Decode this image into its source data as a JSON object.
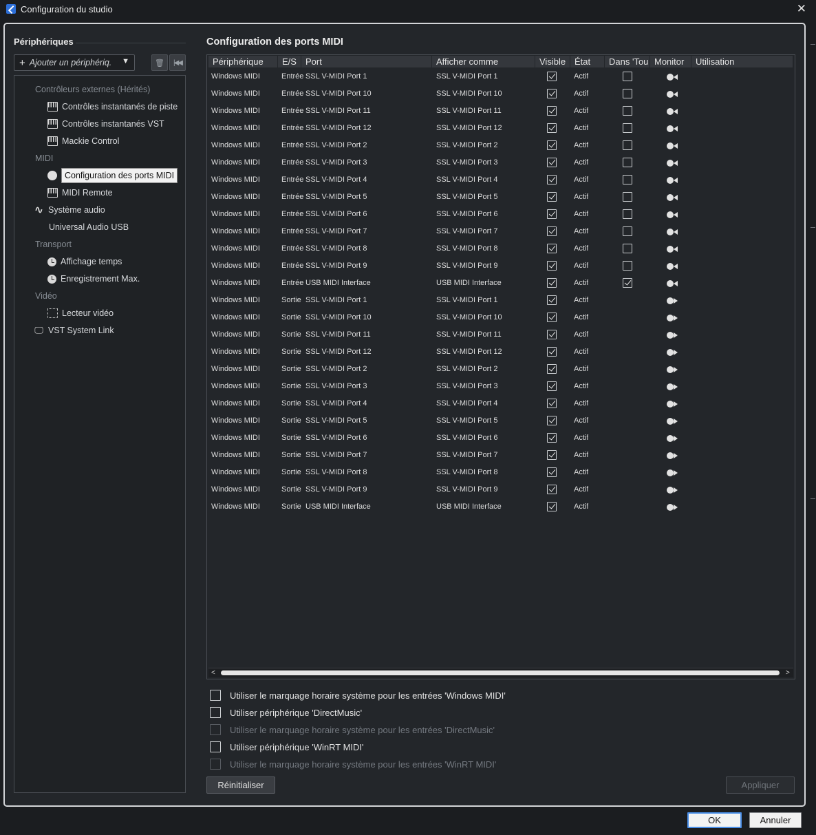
{
  "window": {
    "title": "Configuration du studio"
  },
  "left": {
    "title": "Périphériques",
    "add_device_label": "Ajouter un périphériq.",
    "tree": [
      {
        "label": "Contrôleurs externes (Hérités)",
        "type": "cat",
        "indent": 1,
        "icon": ""
      },
      {
        "label": "Contrôles instantanés de piste",
        "type": "item",
        "indent": 2,
        "icon": "keys-icon"
      },
      {
        "label": "Contrôles instantanés VST",
        "type": "item",
        "indent": 2,
        "icon": "keys-icon"
      },
      {
        "label": "Mackie Control",
        "type": "item",
        "indent": 2,
        "icon": "keys-icon"
      },
      {
        "label": "MIDI",
        "type": "cat",
        "indent": 1,
        "icon": ""
      },
      {
        "label": "Configuration des ports MIDI",
        "type": "item",
        "indent": 2,
        "icon": "midi-din-icon",
        "selected": true
      },
      {
        "label": "MIDI Remote",
        "type": "item",
        "indent": 2,
        "icon": "keys-icon"
      },
      {
        "label": "Système audio",
        "type": "item",
        "indent": 1,
        "icon": "waveform-icon"
      },
      {
        "label": "Universal Audio USB",
        "type": "item",
        "indent": 1.6,
        "icon": ""
      },
      {
        "label": "Transport",
        "type": "cat",
        "indent": 1,
        "icon": ""
      },
      {
        "label": "Affichage temps",
        "type": "item",
        "indent": 2,
        "icon": "clock-icon"
      },
      {
        "label": "Enregistrement Max.",
        "type": "item",
        "indent": 2,
        "icon": "clock-icon"
      },
      {
        "label": "Vidéo",
        "type": "cat",
        "indent": 1,
        "icon": ""
      },
      {
        "label": "Lecteur vidéo",
        "type": "item",
        "indent": 2,
        "icon": "film-icon"
      },
      {
        "label": "VST System Link",
        "type": "item",
        "indent": 1,
        "icon": "monitor-icon"
      }
    ]
  },
  "right": {
    "title": "Configuration des ports MIDI",
    "columns": [
      "Périphérique",
      "E/S",
      "Port",
      "Afficher comme",
      "Visible",
      "État",
      "Dans 'Tou",
      "Monitor",
      "Utilisation"
    ],
    "rows": [
      {
        "device": "Windows MIDI",
        "io": "Entrée",
        "port": "SSL V-MIDI Port 1",
        "display": "SSL V-MIDI Port 1",
        "visible": true,
        "state": "Actif",
        "in_all": false,
        "monitor": "in"
      },
      {
        "device": "Windows MIDI",
        "io": "Entrée",
        "port": "SSL V-MIDI Port 10",
        "display": "SSL V-MIDI Port 10",
        "visible": true,
        "state": "Actif",
        "in_all": false,
        "monitor": "in"
      },
      {
        "device": "Windows MIDI",
        "io": "Entrée",
        "port": "SSL V-MIDI Port 11",
        "display": "SSL V-MIDI Port 11",
        "visible": true,
        "state": "Actif",
        "in_all": false,
        "monitor": "in"
      },
      {
        "device": "Windows MIDI",
        "io": "Entrée",
        "port": "SSL V-MIDI Port 12",
        "display": "SSL V-MIDI Port 12",
        "visible": true,
        "state": "Actif",
        "in_all": false,
        "monitor": "in"
      },
      {
        "device": "Windows MIDI",
        "io": "Entrée",
        "port": "SSL V-MIDI Port 2",
        "display": "SSL V-MIDI Port 2",
        "visible": true,
        "state": "Actif",
        "in_all": false,
        "monitor": "in"
      },
      {
        "device": "Windows MIDI",
        "io": "Entrée",
        "port": "SSL V-MIDI Port 3",
        "display": "SSL V-MIDI Port 3",
        "visible": true,
        "state": "Actif",
        "in_all": false,
        "monitor": "in"
      },
      {
        "device": "Windows MIDI",
        "io": "Entrée",
        "port": "SSL V-MIDI Port 4",
        "display": "SSL V-MIDI Port 4",
        "visible": true,
        "state": "Actif",
        "in_all": false,
        "monitor": "in"
      },
      {
        "device": "Windows MIDI",
        "io": "Entrée",
        "port": "SSL V-MIDI Port 5",
        "display": "SSL V-MIDI Port 5",
        "visible": true,
        "state": "Actif",
        "in_all": false,
        "monitor": "in"
      },
      {
        "device": "Windows MIDI",
        "io": "Entrée",
        "port": "SSL V-MIDI Port 6",
        "display": "SSL V-MIDI Port 6",
        "visible": true,
        "state": "Actif",
        "in_all": false,
        "monitor": "in"
      },
      {
        "device": "Windows MIDI",
        "io": "Entrée",
        "port": "SSL V-MIDI Port 7",
        "display": "SSL V-MIDI Port 7",
        "visible": true,
        "state": "Actif",
        "in_all": false,
        "monitor": "in"
      },
      {
        "device": "Windows MIDI",
        "io": "Entrée",
        "port": "SSL V-MIDI Port 8",
        "display": "SSL V-MIDI Port 8",
        "visible": true,
        "state": "Actif",
        "in_all": false,
        "monitor": "in"
      },
      {
        "device": "Windows MIDI",
        "io": "Entrée",
        "port": "SSL V-MIDI Port 9",
        "display": "SSL V-MIDI Port 9",
        "visible": true,
        "state": "Actif",
        "in_all": false,
        "monitor": "in"
      },
      {
        "device": "Windows MIDI",
        "io": "Entrée",
        "port": "USB MIDI Interface",
        "display": "USB MIDI Interface",
        "visible": true,
        "state": "Actif",
        "in_all": true,
        "monitor": "in"
      },
      {
        "device": "Windows MIDI",
        "io": "Sortie",
        "port": "SSL V-MIDI Port 1",
        "display": "SSL V-MIDI Port 1",
        "visible": true,
        "state": "Actif",
        "monitor": "out"
      },
      {
        "device": "Windows MIDI",
        "io": "Sortie",
        "port": "SSL V-MIDI Port 10",
        "display": "SSL V-MIDI Port 10",
        "visible": true,
        "state": "Actif",
        "monitor": "out"
      },
      {
        "device": "Windows MIDI",
        "io": "Sortie",
        "port": "SSL V-MIDI Port 11",
        "display": "SSL V-MIDI Port 11",
        "visible": true,
        "state": "Actif",
        "monitor": "out"
      },
      {
        "device": "Windows MIDI",
        "io": "Sortie",
        "port": "SSL V-MIDI Port 12",
        "display": "SSL V-MIDI Port 12",
        "visible": true,
        "state": "Actif",
        "monitor": "out"
      },
      {
        "device": "Windows MIDI",
        "io": "Sortie",
        "port": "SSL V-MIDI Port 2",
        "display": "SSL V-MIDI Port 2",
        "visible": true,
        "state": "Actif",
        "monitor": "out"
      },
      {
        "device": "Windows MIDI",
        "io": "Sortie",
        "port": "SSL V-MIDI Port 3",
        "display": "SSL V-MIDI Port 3",
        "visible": true,
        "state": "Actif",
        "monitor": "out"
      },
      {
        "device": "Windows MIDI",
        "io": "Sortie",
        "port": "SSL V-MIDI Port 4",
        "display": "SSL V-MIDI Port 4",
        "visible": true,
        "state": "Actif",
        "monitor": "out"
      },
      {
        "device": "Windows MIDI",
        "io": "Sortie",
        "port": "SSL V-MIDI Port 5",
        "display": "SSL V-MIDI Port 5",
        "visible": true,
        "state": "Actif",
        "monitor": "out"
      },
      {
        "device": "Windows MIDI",
        "io": "Sortie",
        "port": "SSL V-MIDI Port 6",
        "display": "SSL V-MIDI Port 6",
        "visible": true,
        "state": "Actif",
        "monitor": "out"
      },
      {
        "device": "Windows MIDI",
        "io": "Sortie",
        "port": "SSL V-MIDI Port 7",
        "display": "SSL V-MIDI Port 7",
        "visible": true,
        "state": "Actif",
        "monitor": "out"
      },
      {
        "device": "Windows MIDI",
        "io": "Sortie",
        "port": "SSL V-MIDI Port 8",
        "display": "SSL V-MIDI Port 8",
        "visible": true,
        "state": "Actif",
        "monitor": "out"
      },
      {
        "device": "Windows MIDI",
        "io": "Sortie",
        "port": "SSL V-MIDI Port 9",
        "display": "SSL V-MIDI Port 9",
        "visible": true,
        "state": "Actif",
        "monitor": "out"
      },
      {
        "device": "Windows MIDI",
        "io": "Sortie",
        "port": "USB MIDI Interface",
        "display": "USB MIDI Interface",
        "visible": true,
        "state": "Actif",
        "monitor": "out"
      }
    ],
    "options": [
      {
        "label": "Utiliser le marquage horaire système pour les entrées 'Windows MIDI'",
        "enabled": true,
        "checked": false
      },
      {
        "label": "Utiliser périphérique 'DirectMusic'",
        "enabled": true,
        "checked": false
      },
      {
        "label": "Utiliser le marquage horaire système pour les entrées 'DirectMusic'",
        "enabled": false,
        "checked": false
      },
      {
        "label": "Utiliser périphérique 'WinRT MIDI'",
        "enabled": true,
        "checked": false
      },
      {
        "label": "Utiliser le marquage horaire système pour les entrées 'WinRT MIDI'",
        "enabled": false,
        "checked": false
      }
    ],
    "reset_label": "Réinitialiser",
    "apply_label": "Appliquer"
  },
  "footer": {
    "ok_label": "OK",
    "cancel_label": "Annuler"
  },
  "colors": {
    "accent": "#4a8fe8",
    "background": "#23262a",
    "header": "#34373c"
  }
}
